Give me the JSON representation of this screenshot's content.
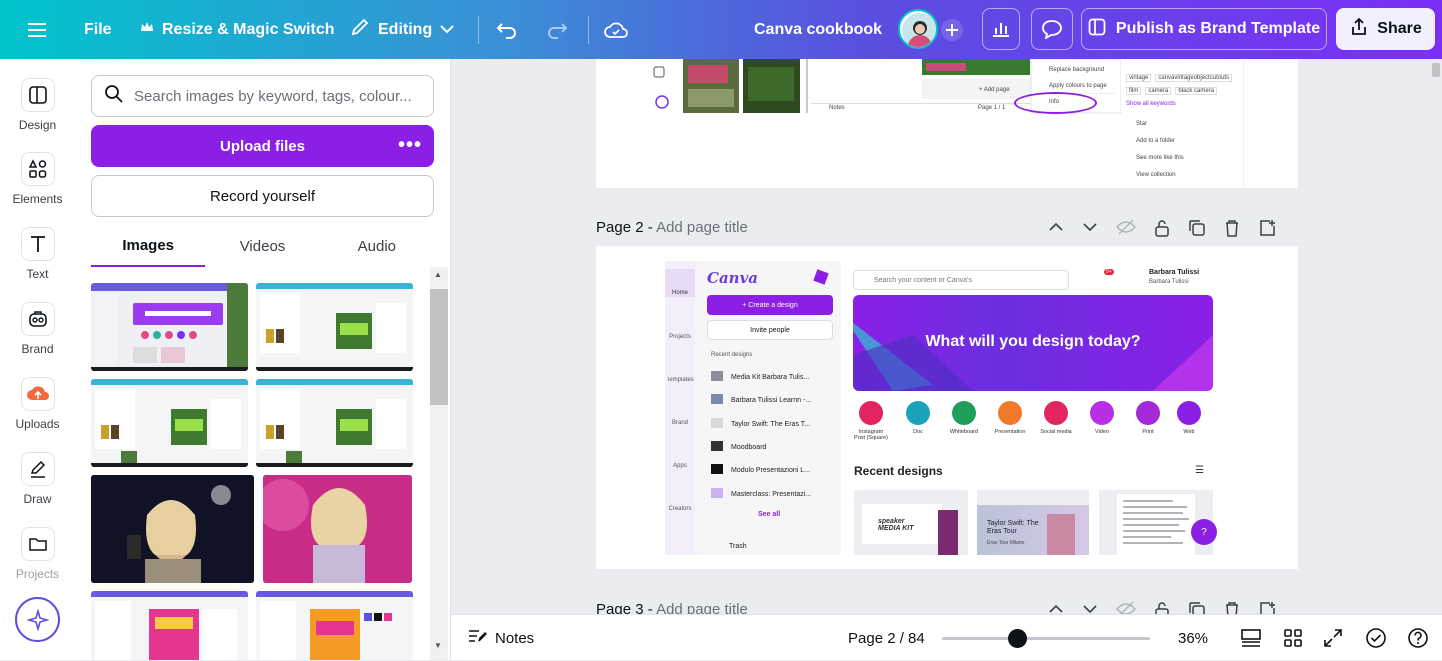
{
  "topbar": {
    "file_label": "File",
    "resize_label": "Resize & Magic Switch",
    "editing_label": "Editing",
    "design_title": "Canva cookbook",
    "publish_label": "Publish as Brand Template",
    "share_label": "Share"
  },
  "rail": {
    "items": [
      {
        "label": "Design",
        "icon": "design-icon"
      },
      {
        "label": "Elements",
        "icon": "elements-icon"
      },
      {
        "label": "Text",
        "icon": "text-icon"
      },
      {
        "label": "Brand",
        "icon": "brand-icon"
      },
      {
        "label": "Uploads",
        "icon": "uploads-icon"
      },
      {
        "label": "Draw",
        "icon": "draw-icon"
      },
      {
        "label": "Projects",
        "icon": "projects-icon"
      }
    ]
  },
  "panel": {
    "search_placeholder": "Search images by keyword, tags, colour...",
    "upload_label": "Upload files",
    "upload_more": "•••",
    "record_label": "Record yourself",
    "tabs": [
      "Images",
      "Videos",
      "Audio"
    ]
  },
  "page1_preview": {
    "menu": [
      "Replace background",
      "Apply colours to page",
      "Info",
      "Star",
      "Add to a folder",
      "See more like this",
      "View collection"
    ],
    "tags": [
      "vintage",
      "canvavintageobjectcutouts",
      "film",
      "camera",
      "black camera"
    ],
    "show_all": "Show all keywords",
    "add_page": "+ Add page",
    "notes": "Notes",
    "page_count": "Page 1 / 1"
  },
  "page2": {
    "title": "Page 2",
    "sub": "Add page title"
  },
  "page3": {
    "title": "Page 3",
    "sub": "Add page title"
  },
  "canva_home": {
    "logo": "Canva",
    "search_placeholder": "Search your content or Canva's",
    "notif_count": "9+",
    "user_name": "Barbara Tulissi",
    "user_sub": "Barbara Tulissi",
    "create_btn": "+ Create a design",
    "invite_btn": "Invite people",
    "recent_label": "Recent designs",
    "nav": [
      "Home",
      "Projects",
      "Templates",
      "Brand",
      "Apps",
      "Creators"
    ],
    "recent": [
      "Media Kit Barbara Tulis...",
      "Barbara Tulissi Learnn -...",
      "Taylor Swift: The Eras T...",
      "Moodboard",
      "Modulo Presentazioni L...",
      "Masterclass: Presentazi..."
    ],
    "see_all": "See all",
    "trash": "Trash",
    "hero": "What will you design today?",
    "types": [
      "Instagram Post (Square)",
      "Doc",
      "Whiteboard",
      "Presentation",
      "Social media",
      "Video",
      "Print",
      "Web"
    ],
    "recent_title": "Recent designs",
    "card2_title": "Taylor Swift: The Eras Tour",
    "card2_sub": "Eras Tour Milano",
    "card1_text": "speaker MEDIA KIT",
    "help": "?"
  },
  "footer": {
    "notes_label": "Notes",
    "page_indicator": "Page 2 / 84",
    "zoom": "36%",
    "zoom_value": 0.36
  },
  "colors": {
    "accent": "#8b1fe6",
    "teal": "#00c4cc"
  }
}
